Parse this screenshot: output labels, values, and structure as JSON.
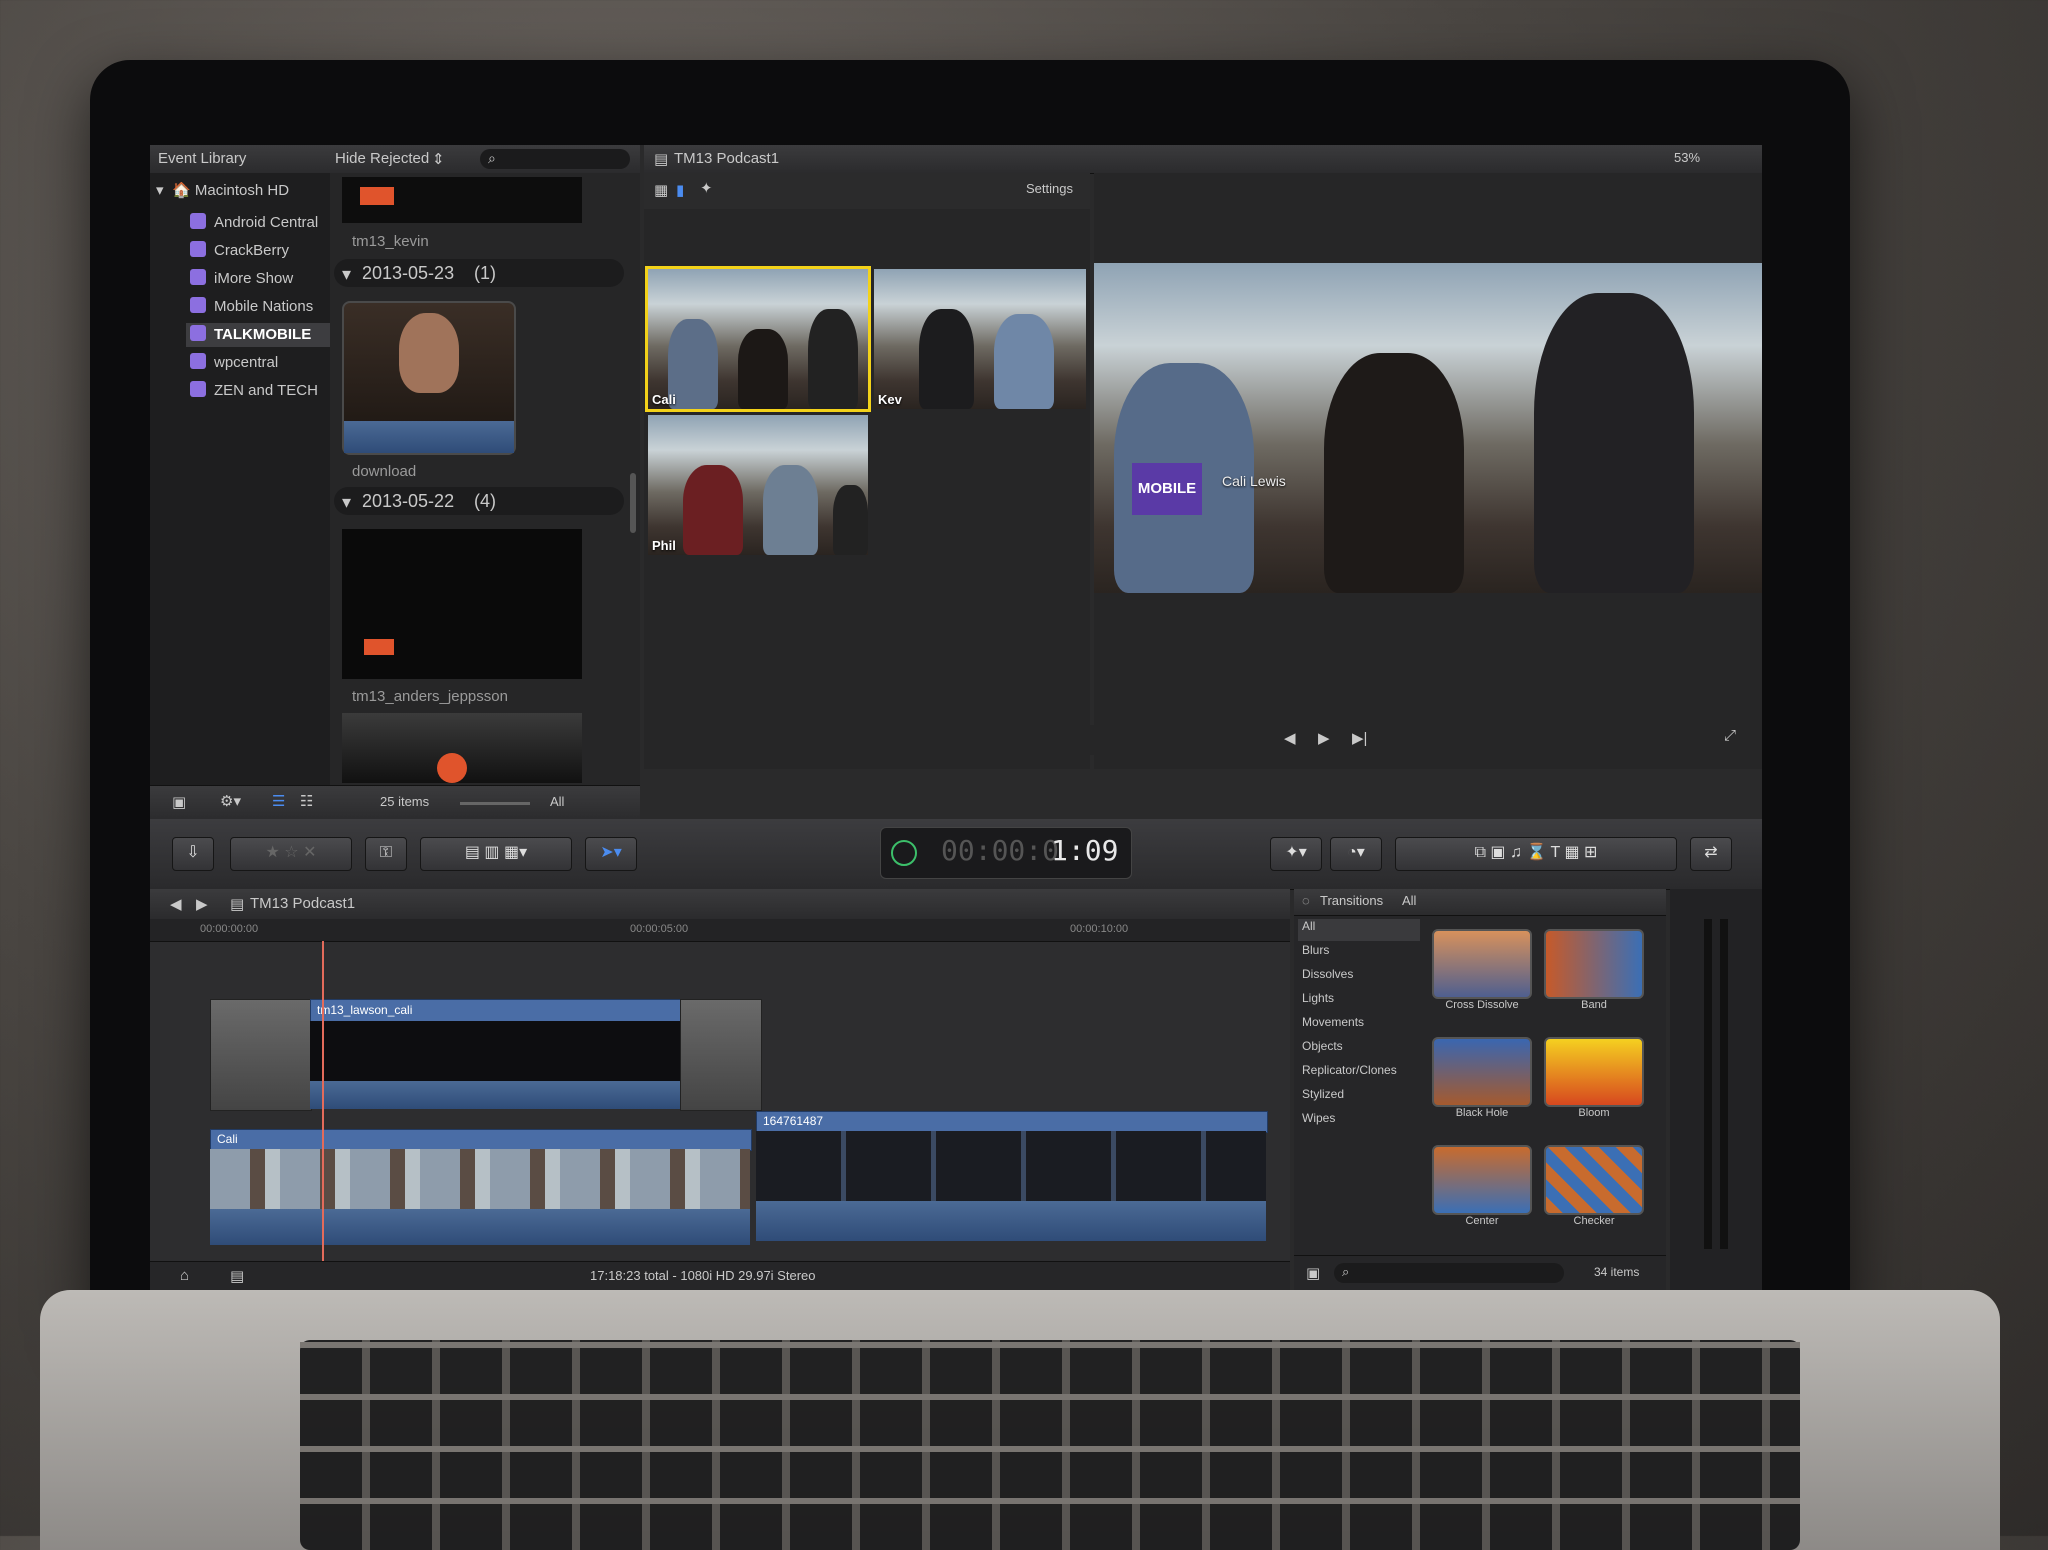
{
  "event_library": {
    "title": "Event Library",
    "filter": "Hide Rejected",
    "root": "Macintosh HD",
    "items": [
      "Android Central",
      "CrackBerry",
      "iMore Show",
      "Mobile Nations",
      "TALKMOBILE",
      "wpcentral",
      "ZEN and TECH"
    ],
    "selected": "TALKMOBILE",
    "clip_top_name": "tm13_kevin",
    "group1_date": "2013-05-23",
    "group1_count": "(1)",
    "group1_clip": "download",
    "group2_date": "2013-05-22",
    "group2_count": "(4)",
    "group2_clip": "tm13_anders_jeppsson",
    "footer_count": "25 items",
    "footer_all": "All"
  },
  "viewer": {
    "title": "TM13 Podcast1",
    "settings": "Settings",
    "zoom": "53%",
    "angle_labels": [
      "Cali",
      "Kev",
      "Phil"
    ],
    "overlay_logo": "MOBILE",
    "overlay_name": "Cali Lewis"
  },
  "timecode": "1:09",
  "timeline": {
    "project": "TM13 Podcast1",
    "tc_start": "00:00:00:00",
    "tc_mid": "00:00:05:00",
    "tc_right": "00:00:10:00",
    "clip_top": "tm13_lawson_cali",
    "clip_main": "Cali",
    "clip_second": "164761487",
    "status": "17:18:23 total - 1080i HD 29.97i Stereo"
  },
  "browser": {
    "title": "Transitions",
    "all": "All",
    "categories": [
      "All",
      "Blurs",
      "Dissolves",
      "Lights",
      "Movements",
      "Objects",
      "Replicator/Clones",
      "Stylized",
      "Wipes"
    ],
    "thumbs": [
      "Cross Dissolve",
      "Band",
      "Black Hole",
      "Bloom",
      "Center",
      "Checker"
    ],
    "count": "34 items"
  }
}
